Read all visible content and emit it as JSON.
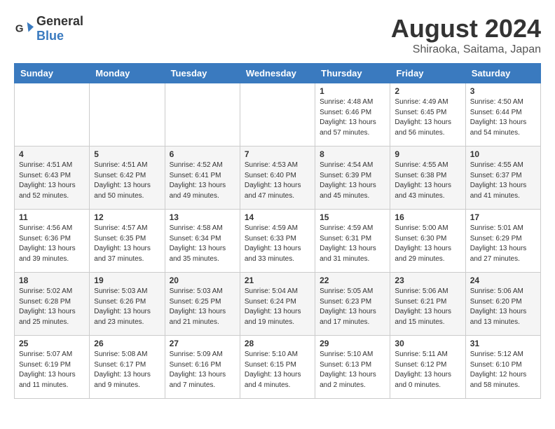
{
  "header": {
    "logo_general": "General",
    "logo_blue": "Blue",
    "month_year": "August 2024",
    "location": "Shiraoka, Saitama, Japan"
  },
  "weekdays": [
    "Sunday",
    "Monday",
    "Tuesday",
    "Wednesday",
    "Thursday",
    "Friday",
    "Saturday"
  ],
  "weeks": [
    [
      {
        "day": "",
        "info": ""
      },
      {
        "day": "",
        "info": ""
      },
      {
        "day": "",
        "info": ""
      },
      {
        "day": "",
        "info": ""
      },
      {
        "day": "1",
        "info": "Sunrise: 4:48 AM\nSunset: 6:46 PM\nDaylight: 13 hours\nand 57 minutes."
      },
      {
        "day": "2",
        "info": "Sunrise: 4:49 AM\nSunset: 6:45 PM\nDaylight: 13 hours\nand 56 minutes."
      },
      {
        "day": "3",
        "info": "Sunrise: 4:50 AM\nSunset: 6:44 PM\nDaylight: 13 hours\nand 54 minutes."
      }
    ],
    [
      {
        "day": "4",
        "info": "Sunrise: 4:51 AM\nSunset: 6:43 PM\nDaylight: 13 hours\nand 52 minutes."
      },
      {
        "day": "5",
        "info": "Sunrise: 4:51 AM\nSunset: 6:42 PM\nDaylight: 13 hours\nand 50 minutes."
      },
      {
        "day": "6",
        "info": "Sunrise: 4:52 AM\nSunset: 6:41 PM\nDaylight: 13 hours\nand 49 minutes."
      },
      {
        "day": "7",
        "info": "Sunrise: 4:53 AM\nSunset: 6:40 PM\nDaylight: 13 hours\nand 47 minutes."
      },
      {
        "day": "8",
        "info": "Sunrise: 4:54 AM\nSunset: 6:39 PM\nDaylight: 13 hours\nand 45 minutes."
      },
      {
        "day": "9",
        "info": "Sunrise: 4:55 AM\nSunset: 6:38 PM\nDaylight: 13 hours\nand 43 minutes."
      },
      {
        "day": "10",
        "info": "Sunrise: 4:55 AM\nSunset: 6:37 PM\nDaylight: 13 hours\nand 41 minutes."
      }
    ],
    [
      {
        "day": "11",
        "info": "Sunrise: 4:56 AM\nSunset: 6:36 PM\nDaylight: 13 hours\nand 39 minutes."
      },
      {
        "day": "12",
        "info": "Sunrise: 4:57 AM\nSunset: 6:35 PM\nDaylight: 13 hours\nand 37 minutes."
      },
      {
        "day": "13",
        "info": "Sunrise: 4:58 AM\nSunset: 6:34 PM\nDaylight: 13 hours\nand 35 minutes."
      },
      {
        "day": "14",
        "info": "Sunrise: 4:59 AM\nSunset: 6:33 PM\nDaylight: 13 hours\nand 33 minutes."
      },
      {
        "day": "15",
        "info": "Sunrise: 4:59 AM\nSunset: 6:31 PM\nDaylight: 13 hours\nand 31 minutes."
      },
      {
        "day": "16",
        "info": "Sunrise: 5:00 AM\nSunset: 6:30 PM\nDaylight: 13 hours\nand 29 minutes."
      },
      {
        "day": "17",
        "info": "Sunrise: 5:01 AM\nSunset: 6:29 PM\nDaylight: 13 hours\nand 27 minutes."
      }
    ],
    [
      {
        "day": "18",
        "info": "Sunrise: 5:02 AM\nSunset: 6:28 PM\nDaylight: 13 hours\nand 25 minutes."
      },
      {
        "day": "19",
        "info": "Sunrise: 5:03 AM\nSunset: 6:26 PM\nDaylight: 13 hours\nand 23 minutes."
      },
      {
        "day": "20",
        "info": "Sunrise: 5:03 AM\nSunset: 6:25 PM\nDaylight: 13 hours\nand 21 minutes."
      },
      {
        "day": "21",
        "info": "Sunrise: 5:04 AM\nSunset: 6:24 PM\nDaylight: 13 hours\nand 19 minutes."
      },
      {
        "day": "22",
        "info": "Sunrise: 5:05 AM\nSunset: 6:23 PM\nDaylight: 13 hours\nand 17 minutes."
      },
      {
        "day": "23",
        "info": "Sunrise: 5:06 AM\nSunset: 6:21 PM\nDaylight: 13 hours\nand 15 minutes."
      },
      {
        "day": "24",
        "info": "Sunrise: 5:06 AM\nSunset: 6:20 PM\nDaylight: 13 hours\nand 13 minutes."
      }
    ],
    [
      {
        "day": "25",
        "info": "Sunrise: 5:07 AM\nSunset: 6:19 PM\nDaylight: 13 hours\nand 11 minutes."
      },
      {
        "day": "26",
        "info": "Sunrise: 5:08 AM\nSunset: 6:17 PM\nDaylight: 13 hours\nand 9 minutes."
      },
      {
        "day": "27",
        "info": "Sunrise: 5:09 AM\nSunset: 6:16 PM\nDaylight: 13 hours\nand 7 minutes."
      },
      {
        "day": "28",
        "info": "Sunrise: 5:10 AM\nSunset: 6:15 PM\nDaylight: 13 hours\nand 4 minutes."
      },
      {
        "day": "29",
        "info": "Sunrise: 5:10 AM\nSunset: 6:13 PM\nDaylight: 13 hours\nand 2 minutes."
      },
      {
        "day": "30",
        "info": "Sunrise: 5:11 AM\nSunset: 6:12 PM\nDaylight: 13 hours\nand 0 minutes."
      },
      {
        "day": "31",
        "info": "Sunrise: 5:12 AM\nSunset: 6:10 PM\nDaylight: 12 hours\nand 58 minutes."
      }
    ]
  ]
}
